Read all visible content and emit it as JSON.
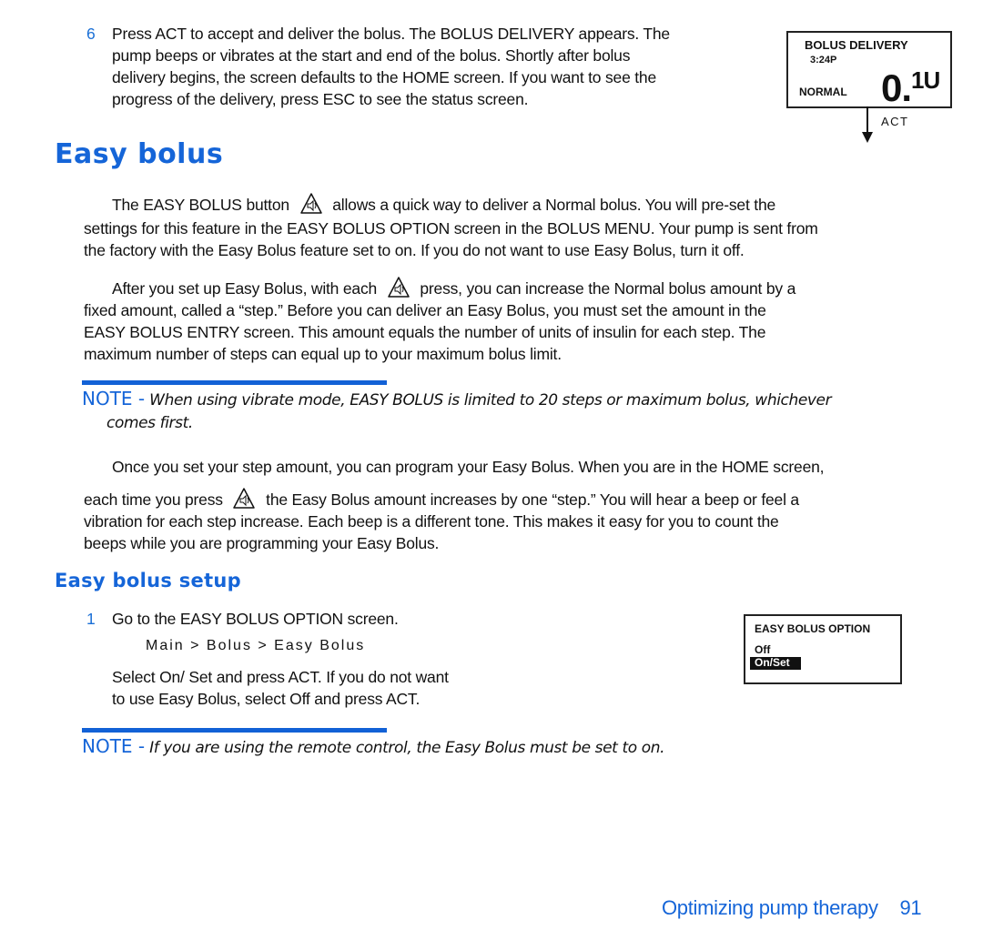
{
  "step6": {
    "number": "6",
    "lines": [
      "Press ACT to accept and deliver the bolus. The BOLUS DELIVERY appears. The",
      "pump beeps or vibrates at the start and end of the bolus. Shortly after bolus",
      "delivery begins, the screen defaults to the HOME screen. If you want to see the",
      "progress of the delivery, press ESC to see the status screen."
    ]
  },
  "bolus_delivery_screen": {
    "title": "BOLUS DELIVERY",
    "time": "3:24P",
    "mode": "NORMAL",
    "amount_int": "0.",
    "amount_dec": "1U",
    "arrow_label": "ACT",
    "arrow_icon": "arrow-down-icon"
  },
  "section": {
    "title": "Easy bolus",
    "para1": {
      "before_icon": "The EASY BOLUS button",
      "after_icon": "allows a quick way to deliver a Normal bolus. You will pre-set the",
      "lines": [
        "settings for this feature in the EASY BOLUS OPTION screen in the BOLUS MENU. Your pump is sent from",
        "the factory with the Easy Bolus feature set to on. If you do not want to use Easy Bolus, turn it off."
      ]
    },
    "para2": {
      "before_icon": "After you set up Easy Bolus, with each",
      "after_icon": "press, you can increase the Normal bolus amount by a",
      "lines": [
        "fixed amount, called a “step.” Before you can deliver an Easy Bolus, you must set the amount in the",
        "EASY BOLUS ENTRY screen. This amount equals the number of units of insulin for each step. The",
        "maximum number of steps can equal up to your maximum bolus limit."
      ]
    },
    "note1": {
      "label": "NOTE -",
      "line1": "When using vibrate mode, EASY BOLUS is limited to 20 steps or maximum bolus, whichever",
      "line2": "comes first."
    },
    "para3": {
      "line1": "Once you set your step amount, you can program your Easy Bolus. When you are in the HOME screen,",
      "before_icon": "each time you press",
      "after_icon": "the Easy Bolus amount increases by one “step.” You will hear a beep or feel a",
      "lines": [
        "vibration for each step increase. Each beep is a different tone. This makes it easy for you to count the",
        "beeps while you are programming your Easy Bolus."
      ]
    },
    "icon": "easy-bolus-button-icon"
  },
  "setup": {
    "title": "Easy bolus setup",
    "step1": {
      "number": "1",
      "text": "Go to the EASY BOLUS OPTION screen.",
      "path": "Main > Bolus > Easy Bolus",
      "lines": [
        "Select On/ Set and press ACT. If you do not want",
        "to use Easy Bolus, select Off and press ACT."
      ]
    },
    "option_screen": {
      "title": "EASY BOLUS OPTION",
      "options": [
        "Off",
        "On/Set"
      ],
      "selected": "On/Set"
    },
    "note2": {
      "label": "NOTE -",
      "text": "If you are using the remote control, the Easy Bolus must be set to on."
    }
  },
  "footer": {
    "chapter": "Optimizing pump therapy",
    "page": "91"
  },
  "colors": {
    "accent": "#1565d8",
    "text": "#111111"
  }
}
